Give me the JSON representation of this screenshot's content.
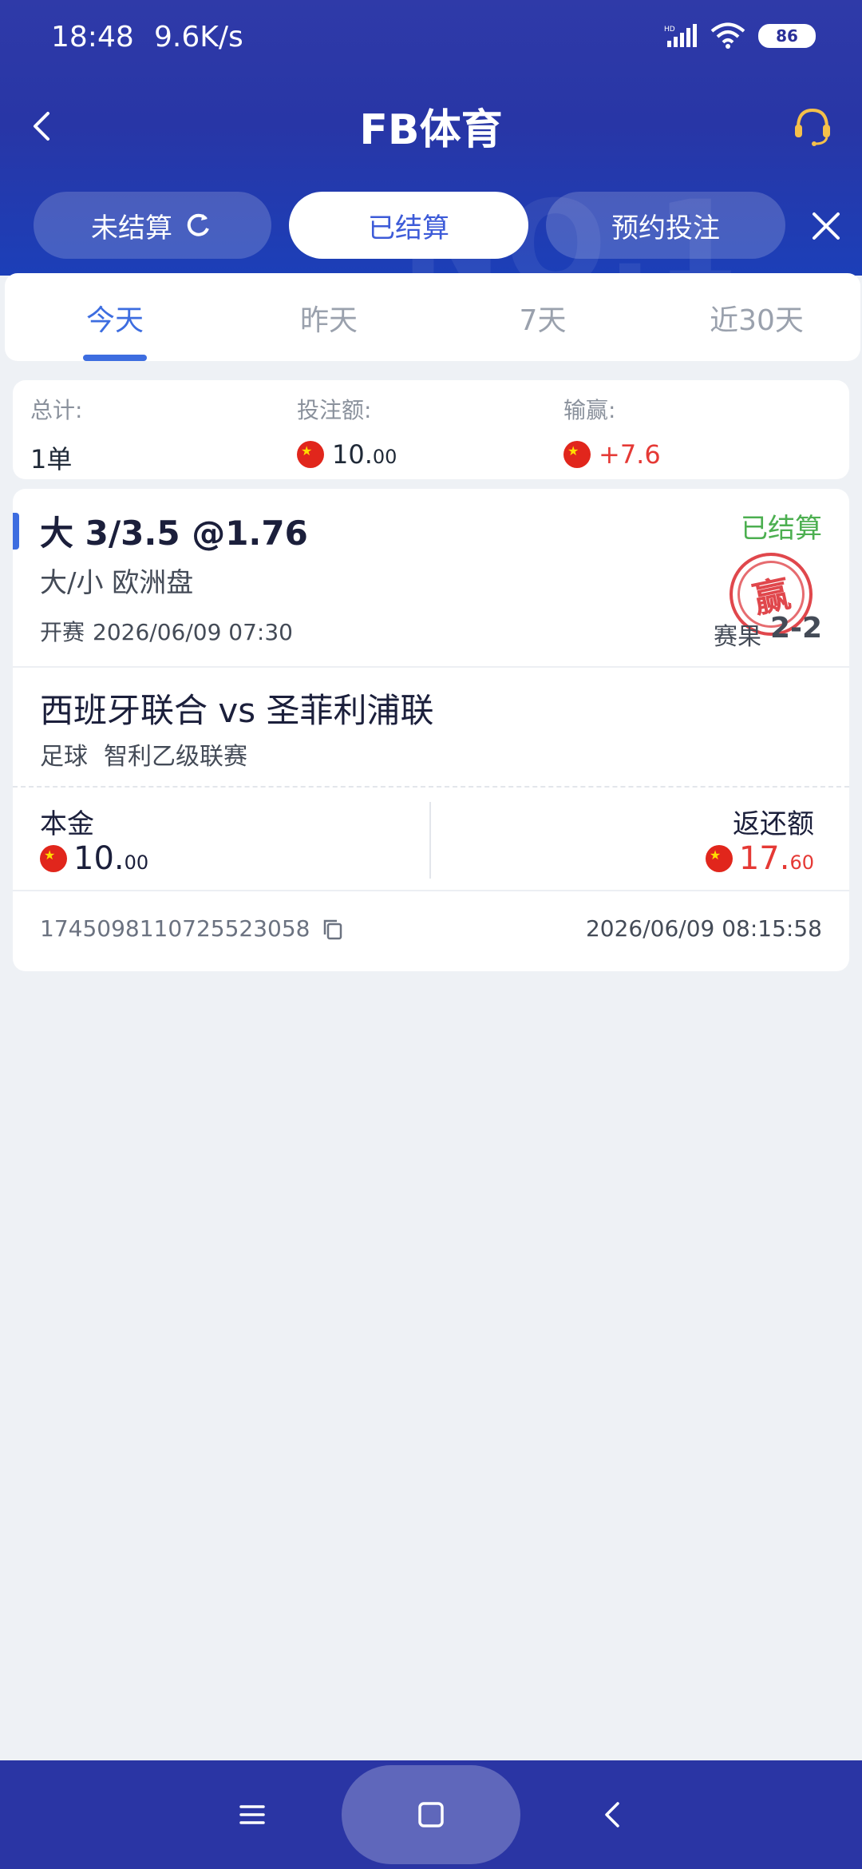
{
  "status_bar": {
    "time": "18:48",
    "speed": "9.6K/s",
    "battery": "86"
  },
  "header": {
    "title": "FB体育"
  },
  "top_tabs": [
    {
      "label": "未结算"
    },
    {
      "label": "已结算"
    },
    {
      "label": "预约投注"
    }
  ],
  "period_tabs": [
    {
      "label": "今天"
    },
    {
      "label": "昨天"
    },
    {
      "label": "7天"
    },
    {
      "label": "近30天"
    }
  ],
  "summary": {
    "total_label": "总计:",
    "total_value": "1单",
    "stake_label": "投注额:",
    "stake_int": "10.",
    "stake_dec": "00",
    "winloss_label": "输赢:",
    "winloss_value": "+7.6"
  },
  "bet": {
    "selection": "大 3/3.5 @1.76",
    "status": "已结算",
    "market": "大/小 欧洲盘",
    "kickoff_label": "开赛",
    "kickoff_time": "2026/06/09 07:30",
    "stamp_text": "赢",
    "score_label": "赛果",
    "score": "2-2",
    "match": "西班牙联合 vs 圣菲利浦联",
    "sport": "足球",
    "league": "智利乙级联赛",
    "principal_label": "本金",
    "principal_int": "10.",
    "principal_dec": "00",
    "return_label": "返还额",
    "return_int": "17.",
    "return_dec": "60",
    "order_id": "1745098110725523058",
    "order_time": "2026/06/09 08:15:58"
  },
  "colors": {
    "accent": "#3d6de0",
    "win": "#4caf50",
    "loss_red": "#e53935",
    "header": "#2836a6"
  }
}
